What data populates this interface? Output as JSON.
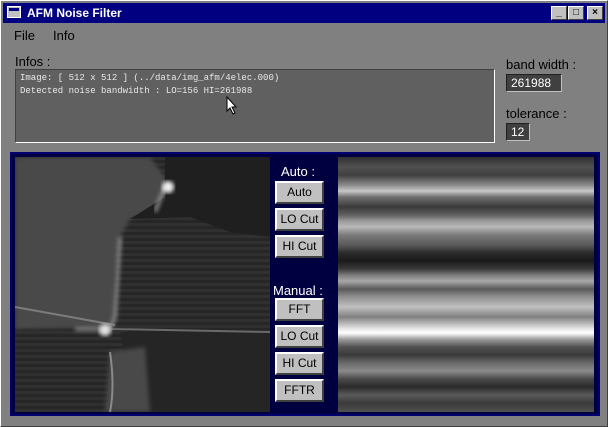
{
  "window": {
    "title": "AFM Noise Filter",
    "minimize_glyph": "_",
    "maximize_glyph": "□",
    "close_glyph": "×"
  },
  "menu": [
    "File",
    "Info"
  ],
  "infos": {
    "label": "Infos :",
    "line1": "Image: [ 512 x 512 ] (../data/img_afm/4elec.000)",
    "line2": "Detected noise bandwidth : LO=156 HI=261988"
  },
  "band_width": {
    "label": "band width :",
    "value": "261988"
  },
  "tolerance": {
    "label": "tolerance :",
    "value": "12"
  },
  "auto": {
    "label": "Auto :",
    "buttons": [
      "Auto",
      "LO Cut",
      "HI Cut"
    ]
  },
  "manual": {
    "label": "Manual :",
    "buttons": [
      "FFT",
      "LO Cut",
      "HI Cut",
      "FFTR"
    ]
  },
  "colors": {
    "title_bar": "#000080",
    "panel_bg": "#000040",
    "window_bg": "#808080"
  }
}
